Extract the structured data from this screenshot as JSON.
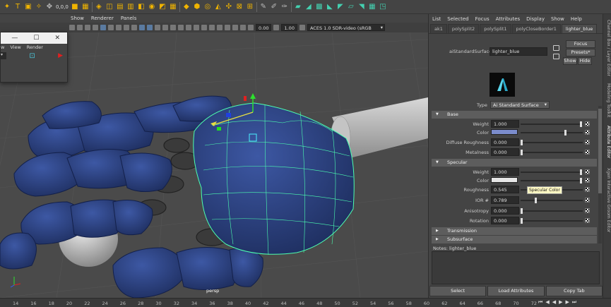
{
  "shelf": {
    "coord_text": "0,0,0"
  },
  "viewport": {
    "menu": [
      "Show",
      "Renderer",
      "Panels"
    ],
    "exposure": "0.00",
    "gamma": "1.00",
    "color_space": "ACES 1.0 SDR-video (sRGB",
    "camera": "persp"
  },
  "float_window": {
    "menu": [
      "View",
      "Render"
    ]
  },
  "attr": {
    "menu": [
      "List",
      "Selected",
      "Focus",
      "Attributes",
      "Display",
      "Show",
      "Help"
    ],
    "tabs": [
      "ak1",
      "polySplit2",
      "polySplit1",
      "polyCloseBorder1",
      "lighter_blue"
    ],
    "node_label": "aiStandardSurface:",
    "node_name": "lighter_blue",
    "focus": "Focus",
    "presets": "Presets*",
    "show": "Show",
    "hide": "Hide",
    "type_label": "Type",
    "type_value": "Ai Standard Surface",
    "sections": {
      "base": "Base",
      "specular": "Specular",
      "transmission": "Transmission",
      "subsurface": "Subsurface"
    },
    "base_rows": [
      {
        "label": "Weight",
        "value": "1.000"
      },
      {
        "label": "Color",
        "color": "#7b8ccc"
      },
      {
        "label": "Diffuse Roughness",
        "value": "0.000"
      },
      {
        "label": "Metalness",
        "value": "0.000"
      }
    ],
    "spec_rows": [
      {
        "label": "Weight",
        "value": "1.000"
      },
      {
        "label": "Color",
        "color": "#e6e6e6"
      },
      {
        "label": "Roughness",
        "value": "0.545"
      },
      {
        "label": "IOR #",
        "value": "0.789"
      },
      {
        "label": "Anisotropy",
        "value": "0.000"
      },
      {
        "label": "Rotation",
        "value": "0.000"
      }
    ],
    "tooltip": "Specular Color",
    "notes_label": "Notes:  lighter_blue",
    "buttons": [
      "Select",
      "Load Attributes",
      "Copy Tab"
    ]
  },
  "vtabs": [
    "Channel Box / Layer Editor",
    "Modeling Toolkit",
    "Attribute Editor",
    "Xgen Interactive Groom Editor"
  ],
  "timeline": {
    "ticks": [
      "14",
      "16",
      "18",
      "20",
      "22",
      "24",
      "26",
      "28",
      "30",
      "32",
      "34",
      "36",
      "38",
      "40",
      "42",
      "44",
      "46",
      "48",
      "50",
      "52",
      "54",
      "56",
      "58",
      "60",
      "62",
      "64",
      "66",
      "68",
      "70",
      "72"
    ]
  },
  "colors": {
    "hand_blue": "#2a3f7a",
    "wireframe": "#4cffb0",
    "base_color": "#7b8ccc"
  }
}
